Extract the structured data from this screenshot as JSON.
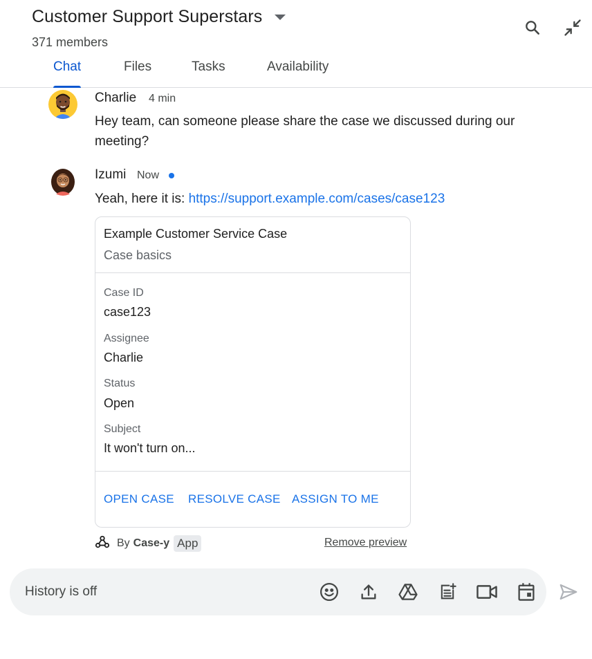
{
  "header": {
    "room_title": "Customer Support Superstars",
    "member_count": "371 members",
    "tabs": [
      {
        "label": "Chat",
        "active": true
      },
      {
        "label": "Files",
        "active": false
      },
      {
        "label": "Tasks",
        "active": false
      },
      {
        "label": "Availability",
        "active": false
      }
    ],
    "icons": [
      "search-icon",
      "collapse-icon",
      "dropdown-caret-icon"
    ]
  },
  "messages": [
    {
      "sender": "Charlie",
      "time": "4 min",
      "text": "Hey team, can someone please share the case we discussed during our meeting?"
    },
    {
      "sender": "Izumi",
      "time": "Now",
      "text_prefix": "Yeah, here it is: ",
      "link": "https://support.example.com/cases/case123"
    }
  ],
  "card": {
    "title": "Example Customer Service Case",
    "subtitle": "Case basics",
    "fields": [
      {
        "label": "Case ID",
        "value": "case123"
      },
      {
        "label": "Assignee",
        "value": "Charlie"
      },
      {
        "label": "Status",
        "value": "Open"
      },
      {
        "label": "Subject",
        "value": "It won't turn on..."
      }
    ],
    "buttons": [
      "OPEN CASE",
      "RESOLVE CASE",
      "ASSIGN TO ME"
    ]
  },
  "attribution": {
    "by": "By",
    "app_name": "Case-y",
    "badge": "App",
    "remove_preview": "Remove preview",
    "icon": "webhook-icon"
  },
  "composer": {
    "placeholder": "History is off",
    "icons": [
      "emoji-icon",
      "upload-icon",
      "drive-icon",
      "add-doc-icon",
      "video-call-icon",
      "calendar-icon",
      "send-icon"
    ]
  },
  "colors": {
    "accent": "#0b57d0",
    "link": "#1a73e8",
    "composer_bg": "#f1f3f4",
    "divider": "#dadce0"
  }
}
